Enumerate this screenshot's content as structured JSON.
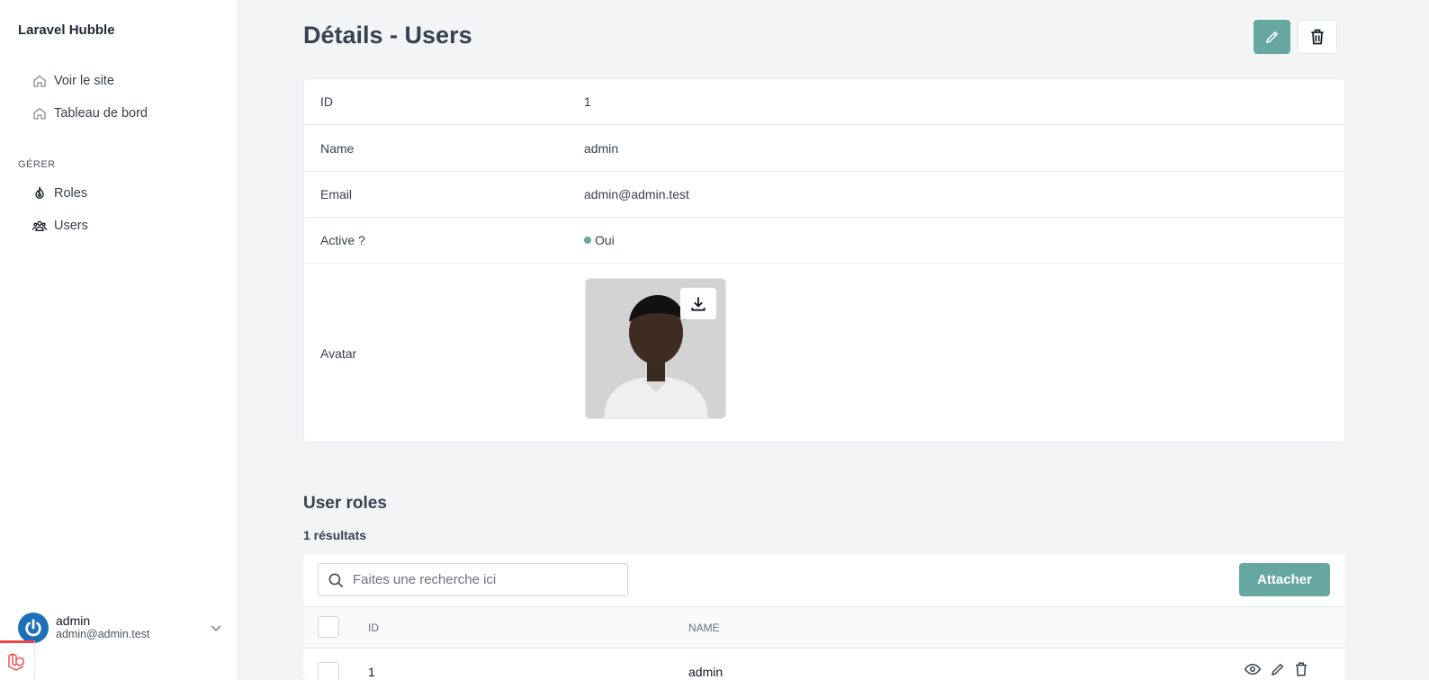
{
  "sidebar": {
    "brand": "Laravel Hubble",
    "links": [
      {
        "label": "Voir le site",
        "icon": "home-icon"
      },
      {
        "label": "Tableau de bord",
        "icon": "home-icon"
      }
    ],
    "section_title": "GÉRER",
    "manage": [
      {
        "label": "Roles",
        "icon": "roles-icon"
      },
      {
        "label": "Users",
        "icon": "users-icon"
      }
    ],
    "user": {
      "name": "admin",
      "email": "admin@admin.test"
    }
  },
  "header": {
    "title": "Détails - Users"
  },
  "details": {
    "fields": [
      {
        "label": "ID",
        "value": "1"
      },
      {
        "label": "Name",
        "value": "admin"
      },
      {
        "label": "Email",
        "value": "admin@admin.test"
      },
      {
        "label": "Active ?",
        "value": "Oui"
      },
      {
        "label": "Avatar",
        "value": ""
      }
    ]
  },
  "relation": {
    "title": "User roles",
    "results": "1 résultats",
    "search_placeholder": "Faites une recherche ici",
    "attach_label": "Attacher",
    "columns": [
      "ID",
      "NAME"
    ],
    "rows": [
      {
        "id": "1",
        "name": "admin"
      }
    ]
  },
  "colors": {
    "accent": "#67a7a2",
    "user_avatar": "#1d6fb8",
    "laravel_red": "#ef4444"
  }
}
